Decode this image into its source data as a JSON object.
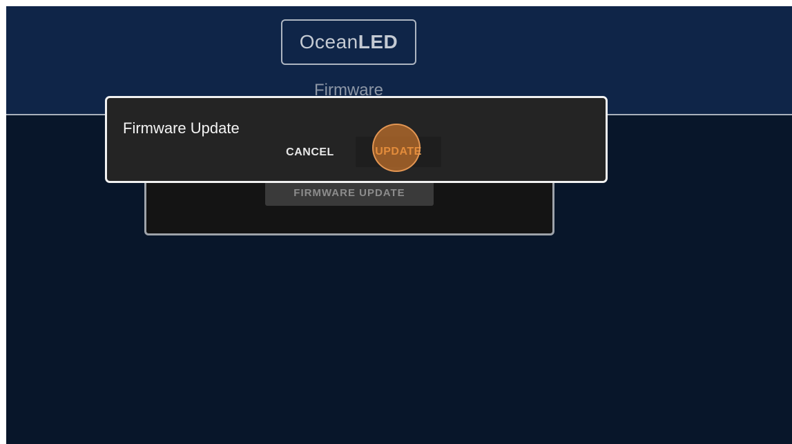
{
  "app": {
    "logo": {
      "light_text": "Ocean",
      "bold_text": "LED"
    },
    "page_title": "Firmware"
  },
  "background_card": {
    "button_label": "FIRMWARE UPDATE"
  },
  "dialog": {
    "title": "Firmware Update",
    "cancel_label": "CANCEL",
    "update_label": "UPDATE"
  },
  "colors": {
    "header": "#0f2548",
    "background": "#08162a",
    "dialog": "#242424",
    "accent": "#e9a052",
    "touch_indicator": "#de802d"
  },
  "touch_indicator": {
    "target": "update-button"
  }
}
